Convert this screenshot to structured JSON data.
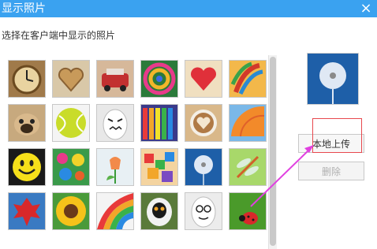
{
  "window": {
    "title": "显示照片",
    "close_glyph": "×"
  },
  "instruction": "选择在客户端中显示的照片",
  "buttons": {
    "upload_label": "本地上传",
    "delete_label": "删除"
  },
  "colors": {
    "titlebar": "#3aa2f0",
    "annotation_red": "#e8484e",
    "annotation_magenta": "#e040e0"
  },
  "photos": [
    {
      "name": "clock"
    },
    {
      "name": "heart-wood"
    },
    {
      "name": "red-car"
    },
    {
      "name": "color-swirl"
    },
    {
      "name": "red-heart"
    },
    {
      "name": "feathers"
    },
    {
      "name": "pug"
    },
    {
      "name": "tennis-ball"
    },
    {
      "name": "angry-egg"
    },
    {
      "name": "crayons"
    },
    {
      "name": "latte-heart"
    },
    {
      "name": "orange-umbrella"
    },
    {
      "name": "smiley"
    },
    {
      "name": "color-drops"
    },
    {
      "name": "tulips"
    },
    {
      "name": "blocks"
    },
    {
      "name": "dandelion"
    },
    {
      "name": "dragonfly"
    },
    {
      "name": "red-leaf"
    },
    {
      "name": "sunflower"
    },
    {
      "name": "rainbow-papers"
    },
    {
      "name": "lemur"
    },
    {
      "name": "egg-face"
    },
    {
      "name": "ladybug"
    }
  ]
}
